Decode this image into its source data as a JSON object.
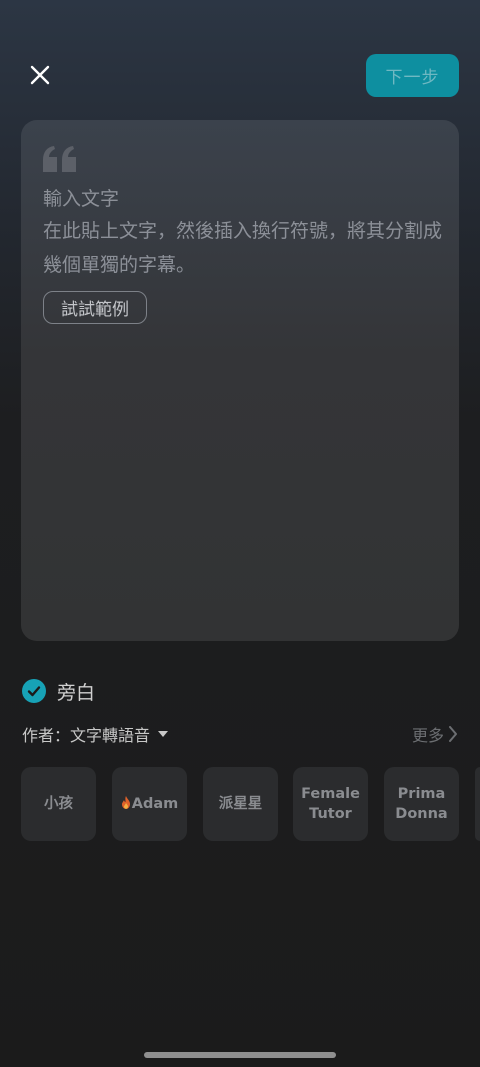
{
  "header": {
    "next_label": "下一步"
  },
  "editor": {
    "title": "輸入文字",
    "hint": "在此貼上文字，然後插入換行符號，將其分割成幾個單獨的字幕。",
    "sample_button": "試試範例"
  },
  "narration": {
    "label": "旁白",
    "checked": true
  },
  "author": {
    "label": "作者：文字轉語音",
    "more": "更多"
  },
  "voices": [
    {
      "label": "小孩"
    },
    {
      "label": "Adam",
      "hot": true
    },
    {
      "label": "派星星"
    },
    {
      "label": "Female Tutor"
    },
    {
      "label": "Prima Donna"
    }
  ],
  "colors": {
    "accent": "#17a2b6",
    "next_button_bg": "#0e8fa0",
    "card_bg": "#343538",
    "tile_bg": "#2b2c2e"
  }
}
